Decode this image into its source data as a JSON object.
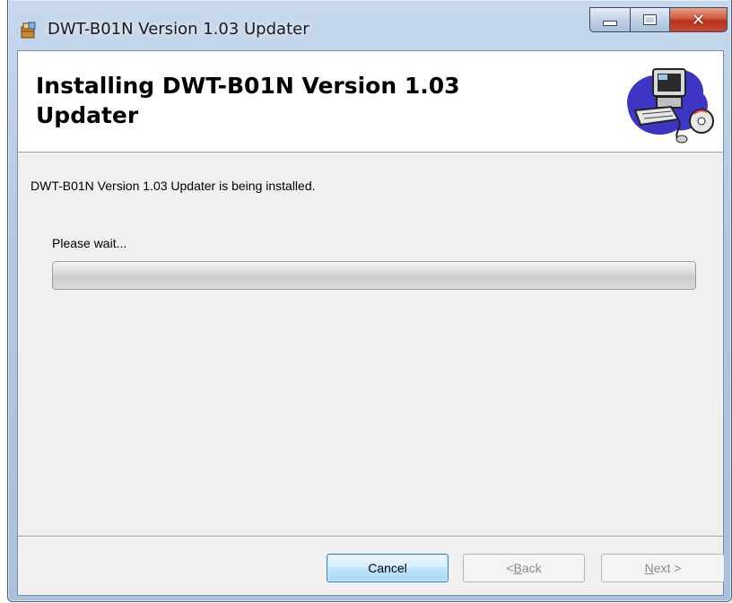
{
  "window": {
    "title": "DWT-B01N Version 1.03 Updater",
    "icons": {
      "app": "installer-icon",
      "minimize": "minimize-icon",
      "maximize": "maximize-icon",
      "close": "close-icon"
    },
    "close_glyph": "✕"
  },
  "header": {
    "title": "Installing DWT-B01N Version 1.03 Updater",
    "art_icon": "computer-cd-icon"
  },
  "body": {
    "status_text": "DWT-B01N Version 1.03 Updater is being installed.",
    "wait_text": "Please wait...",
    "progress": 0
  },
  "buttons": {
    "cancel": "Cancel",
    "back": {
      "prefix": "< ",
      "accel": "B",
      "rest": "ack"
    },
    "next": {
      "prefix": "",
      "accel": "N",
      "rest": "ext >"
    }
  },
  "colors": {
    "close_button": "#c94a32",
    "default_button_border": "#3c7fb1",
    "disabled_text": "#8a8a8a"
  }
}
